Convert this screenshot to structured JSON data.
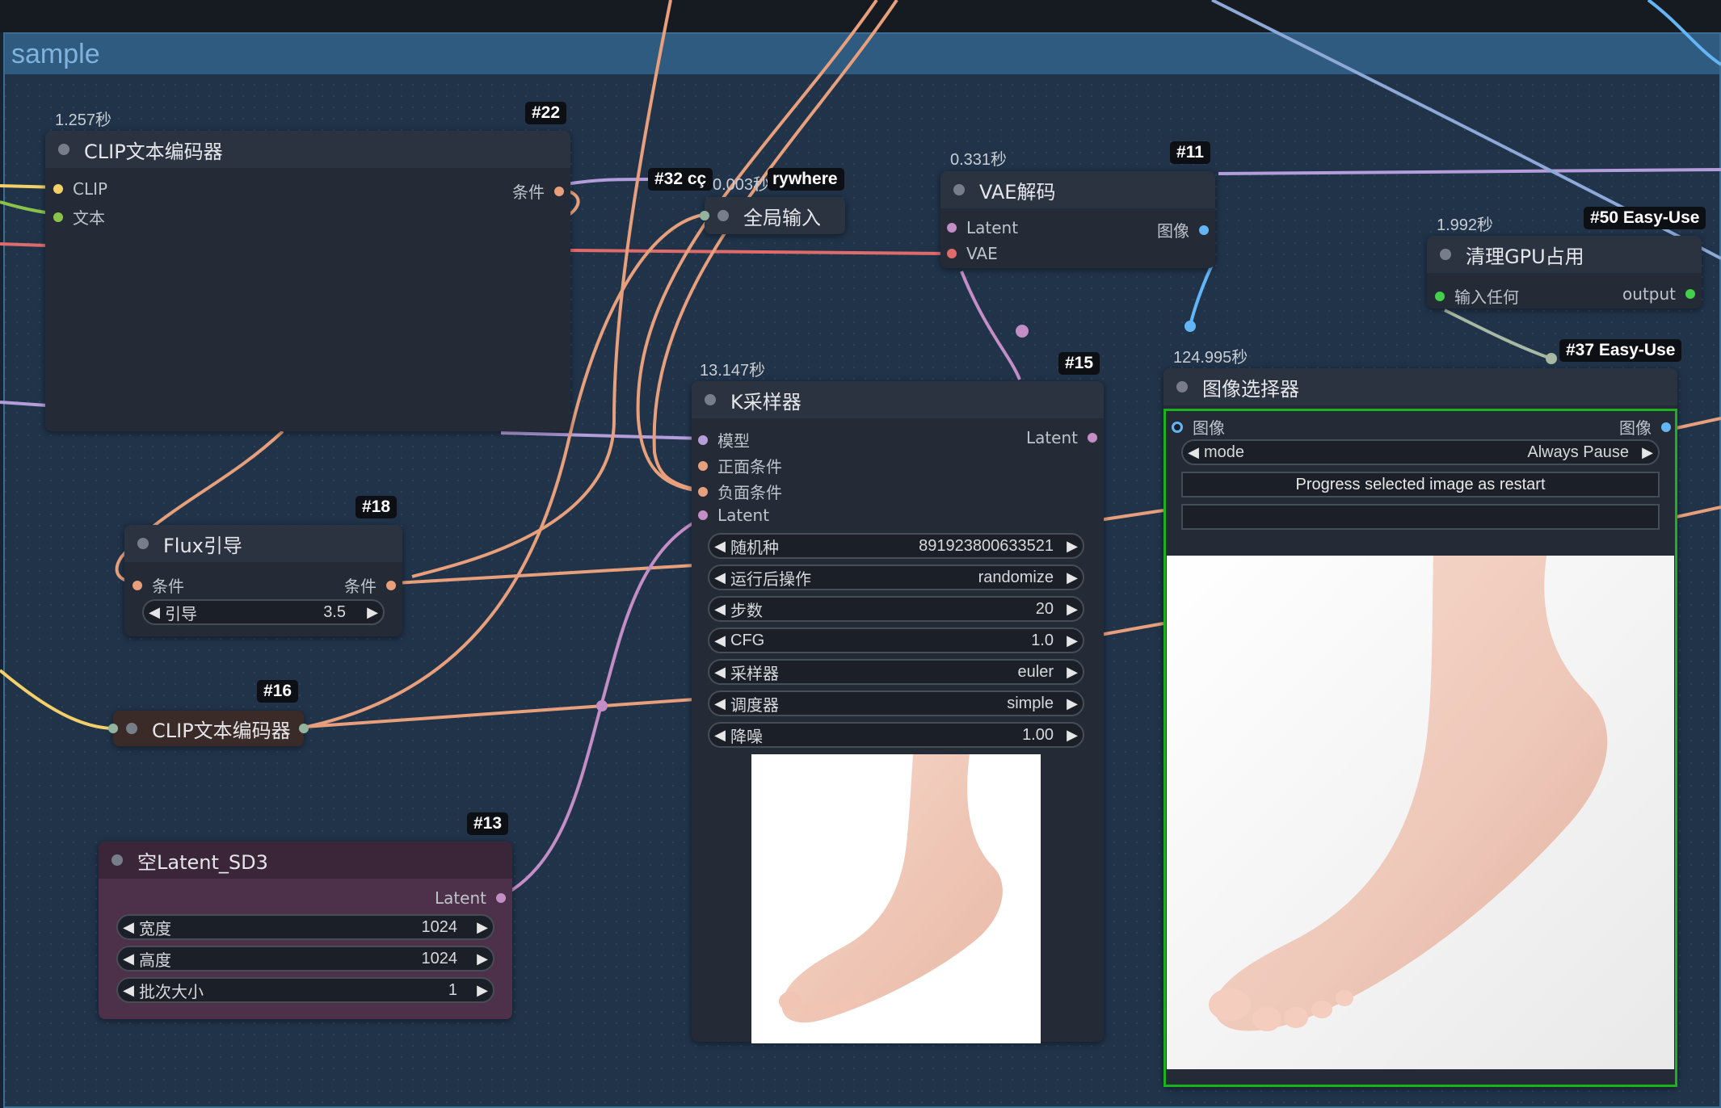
{
  "group": {
    "title": "sample"
  },
  "nodes": {
    "clip22": {
      "badge": "#22",
      "timer": "1.257秒",
      "title": "CLIP文本编码器",
      "in_clip": "CLIP",
      "in_text": "文本",
      "out_cond": "条件"
    },
    "anywhere32": {
      "badge_a": "#32 cç",
      "timer": "0.003秒",
      "badge_b": "rywhere",
      "title": "全局输入"
    },
    "vae11": {
      "badge": "#11",
      "timer": "0.331秒",
      "title": "VAE解码",
      "in_latent": "Latent",
      "in_vae": "VAE",
      "out_image": "图像"
    },
    "gpu50": {
      "badge": "#50 Easy-Use",
      "timer": "1.992秒",
      "title": "清理GPU占用",
      "in_any": "输入任何",
      "out": "output"
    },
    "ks15": {
      "badge": "#15",
      "timer": "13.147秒",
      "title": "K采样器",
      "in_model": "模型",
      "in_pos": "正面条件",
      "in_neg": "负面条件",
      "in_latent": "Latent",
      "out_latent": "Latent",
      "widgets": [
        {
          "label": "随机种",
          "value": "891923800633521"
        },
        {
          "label": "运行后操作",
          "value": "randomize"
        },
        {
          "label": "步数",
          "value": "20"
        },
        {
          "label": "CFG",
          "value": "1.0"
        },
        {
          "label": "采样器",
          "value": "euler"
        },
        {
          "label": "调度器",
          "value": "simple"
        },
        {
          "label": "降噪",
          "value": "1.00"
        }
      ]
    },
    "sel37": {
      "badge": "#37 Easy-Use",
      "timer": "124.995秒",
      "title": "图像选择器",
      "in_image": "图像",
      "out_image": "图像",
      "mode_label": "mode",
      "mode_value": "Always Pause",
      "button": "Progress selected image as restart",
      "text_value": ""
    },
    "flux18": {
      "badge": "#18",
      "title": "Flux引导",
      "in_cond": "条件",
      "out_cond": "条件",
      "w_label": "引导",
      "w_value": "3.5"
    },
    "clip16": {
      "badge": "#16",
      "title": "CLIP文本编码器"
    },
    "latent13": {
      "badge": "#13",
      "title": "空Latent_SD3",
      "out_latent": "Latent",
      "widgets": [
        {
          "label": "宽度",
          "value": "1024"
        },
        {
          "label": "高度",
          "value": "1024"
        },
        {
          "label": "批次大小",
          "value": "1"
        }
      ]
    }
  },
  "colors": {
    "clip": "#f3d06a",
    "conditioning": "#e79f7c",
    "model": "#b39ddb",
    "latent": "#c38dc6",
    "vae": "#e06b6b",
    "image": "#64b5f6",
    "any": "#43d04a",
    "selected": "#1bb21b"
  },
  "icons": {
    "arrow_left": "◀",
    "arrow_right": "▶"
  }
}
